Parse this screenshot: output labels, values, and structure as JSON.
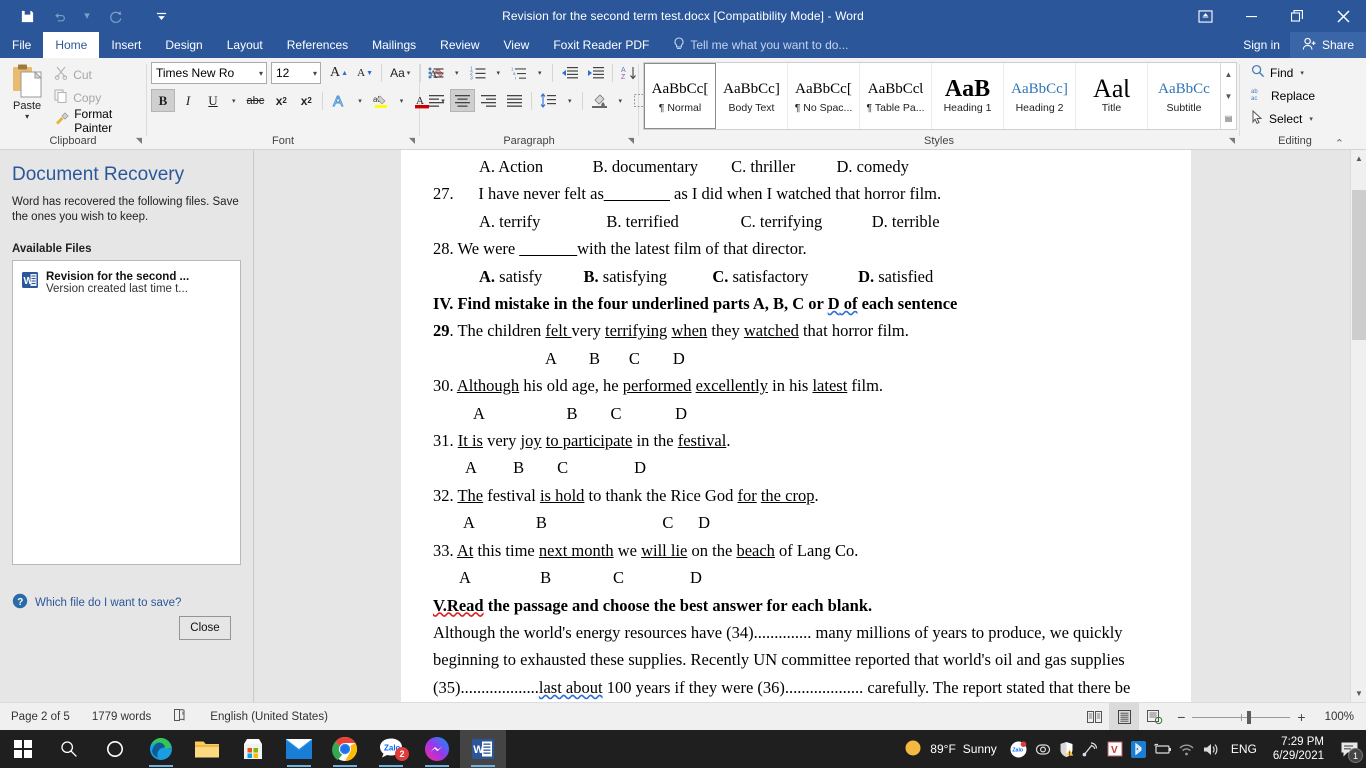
{
  "titlebar": {
    "title": "Revision for the second term test.docx [Compatibility Mode] - Word",
    "qat": [
      {
        "name": "save",
        "glyph": "💾"
      },
      {
        "name": "undo",
        "glyph": "↶"
      },
      {
        "name": "redo",
        "glyph": "↻"
      },
      {
        "name": "customize",
        "glyph": "─"
      }
    ],
    "restore_ribbon_icon": "ribbon-display-options",
    "minimize": "–",
    "maximize": "❐",
    "close": "✕"
  },
  "tabs": [
    {
      "label": "File",
      "active": false
    },
    {
      "label": "Home",
      "active": true
    },
    {
      "label": "Insert",
      "active": false
    },
    {
      "label": "Design",
      "active": false
    },
    {
      "label": "Layout",
      "active": false
    },
    {
      "label": "References",
      "active": false
    },
    {
      "label": "Mailings",
      "active": false
    },
    {
      "label": "Review",
      "active": false
    },
    {
      "label": "View",
      "active": false
    },
    {
      "label": "Foxit Reader PDF",
      "active": false
    }
  ],
  "tellme": {
    "placeholder": "Tell me what you want to do..."
  },
  "account": {
    "signin": "Sign in",
    "share": "Share"
  },
  "ribbon": {
    "clipboard": {
      "group_label": "Clipboard",
      "paste": "Paste",
      "cut": "Cut",
      "copy": "Copy",
      "format_painter": "Format Painter"
    },
    "font": {
      "group_label": "Font",
      "font_name": "Times New Ro",
      "font_size": "12",
      "grow_font": "A",
      "shrink_font": "A",
      "change_case": "Aa",
      "clear_formatting": "clear-formatting-icon",
      "bold": "B",
      "italic": "I",
      "underline": "U",
      "strikethrough": "abc",
      "subscript": "x₂",
      "superscript": "x²",
      "text_effects": "A",
      "highlight": "ab",
      "font_color": "A"
    },
    "paragraph": {
      "group_label": "Paragraph",
      "bullets": "bullets-icon",
      "numbering": "numbering-icon",
      "multilevel": "multilevel-list-icon",
      "decrease_indent": "decrease-indent-icon",
      "increase_indent": "increase-indent-icon",
      "sort": "sort-icon",
      "show_marks": "¶",
      "align_left": "align-left-icon",
      "align_center": "align-center-icon",
      "align_right": "align-right-icon",
      "justify": "justify-icon",
      "line_spacing": "line-spacing-icon",
      "shading": "shading-icon",
      "borders": "borders-icon"
    },
    "styles": {
      "group_label": "Styles",
      "items": [
        {
          "preview": "AaBbCc[",
          "name": "¶ Normal",
          "selected": true,
          "kind": "normal"
        },
        {
          "preview": "AaBbCc]",
          "name": "Body Text",
          "selected": false,
          "kind": "normal"
        },
        {
          "preview": "AaBbCc[",
          "name": "¶ No Spac...",
          "selected": false,
          "kind": "normal"
        },
        {
          "preview": "AaBbCcƖ",
          "name": "¶ Table Pa...",
          "selected": false,
          "kind": "normal"
        },
        {
          "preview": "AaB",
          "name": "Heading 1",
          "selected": false,
          "kind": "h1"
        },
        {
          "preview": "AaBbCc]",
          "name": "Heading 2",
          "selected": false,
          "kind": "h2"
        },
        {
          "preview": "AaƖ",
          "name": "Title",
          "selected": false,
          "kind": "title"
        },
        {
          "preview": "AaBbCc",
          "name": "Subtitle",
          "selected": false,
          "kind": "sub"
        }
      ]
    },
    "editing": {
      "group_label": "Editing",
      "find": "Find",
      "replace": "Replace",
      "select": "Select"
    }
  },
  "recovery": {
    "title": "Document Recovery",
    "description": "Word has recovered the following files. Save the ones you wish to keep.",
    "available_files_label": "Available Files",
    "files": [
      {
        "name": "Revision for the second ...",
        "subtitle": "Version created last time t..."
      }
    ],
    "help_link": "Which file do I want to save?",
    "close_button": "Close"
  },
  "document": {
    "lines": [
      {
        "id": "l26opts",
        "indent": 46,
        "runs": [
          {
            "t": "A. Action"
          },
          {
            "t": "            ",
            "sp": true
          },
          {
            "t": "B. documentary"
          },
          {
            "t": "        ",
            "sp": true
          },
          {
            "t": "C. thriller"
          },
          {
            "t": "          ",
            "sp": true
          },
          {
            "t": "D. comedy"
          }
        ]
      },
      {
        "id": "l27",
        "indent": 0,
        "runs": [
          {
            "t": "27."
          },
          {
            "t": "      ",
            "sp": true
          },
          {
            "t": "I have never felt as"
          },
          {
            "t": "________",
            "blank": true
          },
          {
            "t": " as I did when I watched that horror film."
          }
        ]
      },
      {
        "id": "l27opts",
        "indent": 46,
        "runs": [
          {
            "t": "A. terrify"
          },
          {
            "t": "                ",
            "sp": true
          },
          {
            "t": "B. terrified"
          },
          {
            "t": "               ",
            "sp": true
          },
          {
            "t": "C. terrifying"
          },
          {
            "t": "            ",
            "sp": true
          },
          {
            "t": "D. terrible"
          }
        ]
      },
      {
        "id": "l28",
        "indent": 0,
        "runs": [
          {
            "t": "28. We were "
          },
          {
            "t": "_______",
            "blank": true
          },
          {
            "t": "with the latest film of that director."
          }
        ]
      },
      {
        "id": "l28opts",
        "indent": 46,
        "runs": [
          {
            "t": "A.",
            "b": true
          },
          {
            "t": " satisfy"
          },
          {
            "t": "          ",
            "sp": true
          },
          {
            "t": "B.",
            "b": true
          },
          {
            "t": " satisfying"
          },
          {
            "t": "           ",
            "sp": true
          },
          {
            "t": "C.",
            "b": true
          },
          {
            "t": " satisfactory"
          },
          {
            "t": "            ",
            "sp": true
          },
          {
            "t": "D.",
            "b": true
          },
          {
            "t": " satisfied"
          }
        ]
      },
      {
        "id": "lIV",
        "indent": 0,
        "runs": [
          {
            "t": "IV. Find mistake in the four underlined parts A, B, C or ",
            "b": true
          },
          {
            "t": "D",
            "b": true,
            "sqb": true
          },
          {
            "t": " of",
            "b": true,
            "sqb": true
          },
          {
            "t": " each sentence",
            "b": true
          }
        ]
      },
      {
        "id": "l29",
        "indent": 0,
        "runs": [
          {
            "t": "29",
            "b": true
          },
          {
            "t": ". The children "
          },
          {
            "t": "felt ",
            "u": true
          },
          {
            "t": "very "
          },
          {
            "t": "terrifying",
            "u": true
          },
          {
            "t": " "
          },
          {
            "t": "when",
            "u": true
          },
          {
            "t": " they "
          },
          {
            "t": "watched",
            "u": true
          },
          {
            "t": " that horror film."
          }
        ]
      },
      {
        "id": "l29abcd",
        "indent": 112,
        "runs": [
          {
            "t": "A"
          },
          {
            "t": "        ",
            "sp": true
          },
          {
            "t": "B"
          },
          {
            "t": "       ",
            "sp": true
          },
          {
            "t": "C"
          },
          {
            "t": "        ",
            "sp": true
          },
          {
            "t": "D"
          }
        ]
      },
      {
        "id": "l30",
        "indent": 0,
        "runs": [
          {
            "t": "30. "
          },
          {
            "t": "Although",
            "u": true
          },
          {
            "t": " his old age, he "
          },
          {
            "t": "performed",
            "u": true
          },
          {
            "t": " "
          },
          {
            "t": "excellently",
            "u": true
          },
          {
            "t": " in his "
          },
          {
            "t": "latest",
            "u": true
          },
          {
            "t": " film."
          }
        ]
      },
      {
        "id": "l30abcd",
        "indent": 40,
        "runs": [
          {
            "t": "A"
          },
          {
            "t": "                    ",
            "sp": true
          },
          {
            "t": "B"
          },
          {
            "t": "        ",
            "sp": true
          },
          {
            "t": "C"
          },
          {
            "t": "             ",
            "sp": true
          },
          {
            "t": "D"
          }
        ]
      },
      {
        "id": "l31",
        "indent": 0,
        "runs": [
          {
            "t": "31. "
          },
          {
            "t": "It is",
            "u": true
          },
          {
            "t": " very "
          },
          {
            "t": "joy",
            "u": true
          },
          {
            "t": " "
          },
          {
            "t": "to participate",
            "u": true
          },
          {
            "t": " in the "
          },
          {
            "t": "festival",
            "u": true
          },
          {
            "t": "."
          }
        ]
      },
      {
        "id": "l31abcd",
        "indent": 32,
        "runs": [
          {
            "t": "A"
          },
          {
            "t": "         ",
            "sp": true
          },
          {
            "t": "B"
          },
          {
            "t": "        ",
            "sp": true
          },
          {
            "t": "C"
          },
          {
            "t": "                ",
            "sp": true
          },
          {
            "t": "D"
          }
        ]
      },
      {
        "id": "l32",
        "indent": 0,
        "runs": [
          {
            "t": "32. "
          },
          {
            "t": "The",
            "u": true
          },
          {
            "t": " festival "
          },
          {
            "t": "is hold",
            "u": true
          },
          {
            "t": " to thank the Rice God "
          },
          {
            "t": "for",
            "u": true
          },
          {
            "t": " "
          },
          {
            "t": "the crop",
            "u": true
          },
          {
            "t": "."
          }
        ]
      },
      {
        "id": "l32abcd",
        "indent": 30,
        "runs": [
          {
            "t": "A"
          },
          {
            "t": "               ",
            "sp": true
          },
          {
            "t": "B"
          },
          {
            "t": "                            ",
            "sp": true
          },
          {
            "t": "C"
          },
          {
            "t": "      ",
            "sp": true
          },
          {
            "t": "D"
          }
        ]
      },
      {
        "id": "l33",
        "indent": 0,
        "runs": [
          {
            "t": "33. "
          },
          {
            "t": "At",
            "u": true
          },
          {
            "t": " this time "
          },
          {
            "t": "next month",
            "u": true
          },
          {
            "t": " we "
          },
          {
            "t": "will lie",
            "u": true
          },
          {
            "t": " on the "
          },
          {
            "t": "beach",
            "u": true
          },
          {
            "t": " of Lang Co."
          }
        ]
      },
      {
        "id": "l33abcd",
        "indent": 26,
        "runs": [
          {
            "t": "A"
          },
          {
            "t": "                 ",
            "sp": true
          },
          {
            "t": "B"
          },
          {
            "t": "               ",
            "sp": true
          },
          {
            "t": "C"
          },
          {
            "t": "                ",
            "sp": true
          },
          {
            "t": "D"
          }
        ]
      },
      {
        "id": "lV",
        "indent": 0,
        "runs": [
          {
            "t": "V.Read",
            "b": true,
            "sqr": true
          },
          {
            "t": " the passage and choose the best answer for each blank.",
            "b": true
          }
        ]
      },
      {
        "id": "p1",
        "indent": 0,
        "runs": [
          {
            "t": "Although the world's energy resources have (34).............. many millions of years to produce, we quickly"
          }
        ]
      },
      {
        "id": "p2",
        "indent": 0,
        "runs": [
          {
            "t": "beginning to exhausted  these supplies. Recently UN committee reported that world's oil and gas supplies"
          }
        ]
      },
      {
        "id": "p3",
        "indent": 0,
        "runs": [
          {
            "t": "(35)..................."
          },
          {
            "t": "last  about",
            "sqb": true
          },
          {
            "t": " 100 years if they were  (36)................... carefully. The report stated that there be"
          }
        ]
      }
    ]
  },
  "statusbar": {
    "page": "Page 2 of 5",
    "words": "1779 words",
    "proofing_icon": "proofing-errors-icon",
    "language": "English (United States)",
    "views": [
      {
        "name": "read-mode",
        "icon": "read-mode-icon",
        "active": false
      },
      {
        "name": "print-layout",
        "icon": "print-layout-icon",
        "active": true
      },
      {
        "name": "web-layout",
        "icon": "web-layout-icon",
        "active": false
      }
    ],
    "zoom_out": "−",
    "zoom_in": "+",
    "zoom_level": "100%"
  },
  "taskbar": {
    "start": "start-icon",
    "search": "search-icon",
    "cortana": "cortana-icon",
    "apps": [
      {
        "name": "edge",
        "label": "Microsoft Edge",
        "running": true,
        "active": false,
        "badge": null
      },
      {
        "name": "file-explorer",
        "label": "File Explorer",
        "running": false,
        "active": false,
        "badge": null
      },
      {
        "name": "microsoft-store",
        "label": "Microsoft Store",
        "running": false,
        "active": false,
        "badge": null
      },
      {
        "name": "mail",
        "label": "Mail",
        "running": true,
        "active": false,
        "badge": null
      },
      {
        "name": "chrome",
        "label": "Google Chrome",
        "running": true,
        "active": false,
        "badge": null
      },
      {
        "name": "zalo",
        "label": "Zalo",
        "running": true,
        "active": false,
        "badge": "2"
      },
      {
        "name": "messenger",
        "label": "Messenger",
        "running": true,
        "active": false,
        "badge": null
      },
      {
        "name": "word",
        "label": "Word",
        "running": true,
        "active": true,
        "badge": null
      }
    ],
    "weather": {
      "temp": "89°F",
      "condition": "Sunny",
      "icon": "sun-icon"
    },
    "tray_icons": [
      {
        "name": "zalo-tray-icon"
      },
      {
        "name": "camera-tray-icon"
      },
      {
        "name": "security-warning-icon"
      },
      {
        "name": "antenna-tray-icon"
      },
      {
        "name": "v-app-tray-icon"
      },
      {
        "name": "bluetooth-icon"
      },
      {
        "name": "battery-icon"
      },
      {
        "name": "wifi-icon"
      },
      {
        "name": "volume-icon"
      }
    ],
    "language": "ENG",
    "time": "7:29 PM",
    "date": "6/29/2021",
    "action_center_badge": "1"
  },
  "colors": {
    "word_blue": "#2b579a",
    "ribbon_bg": "#f3f3f3",
    "accent_heading": "#2e74b5",
    "taskbar": "#1f1f1f"
  }
}
